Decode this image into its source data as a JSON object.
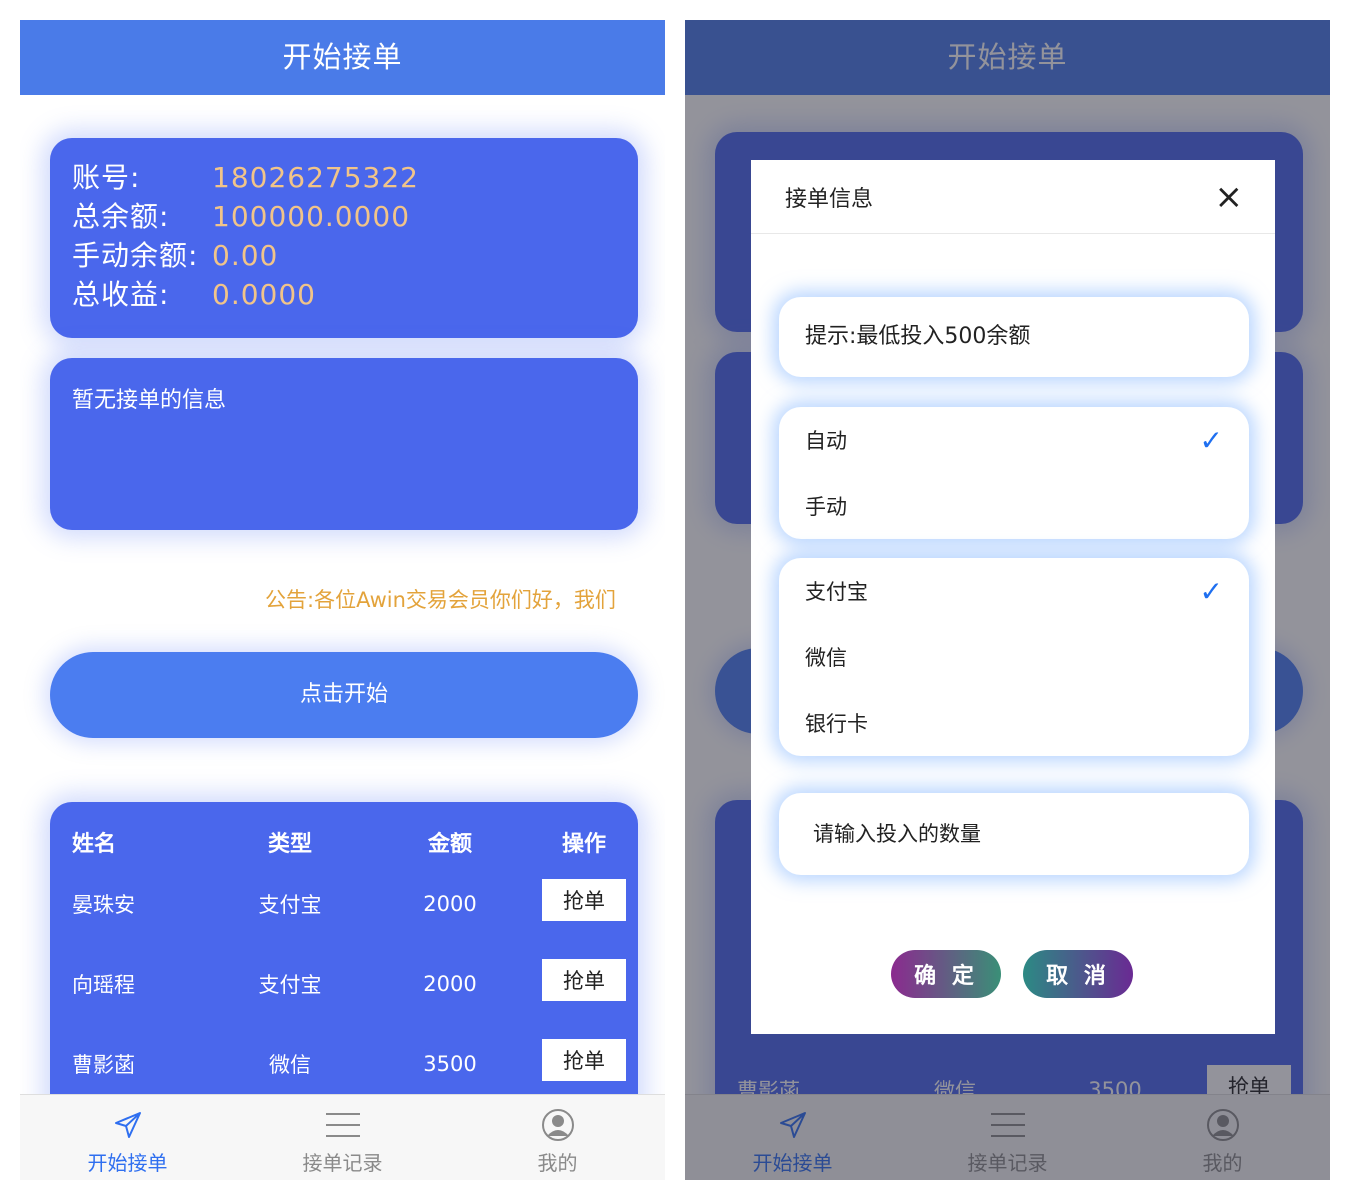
{
  "colors": {
    "header": "#4a7be8",
    "card": "#4a67ec",
    "accent_value": "#f1c489",
    "notice": "#e3a33b",
    "tab_active": "#2f6ff0",
    "check": "#1e6ff0"
  },
  "left": {
    "header_title": "开始接单",
    "account": [
      {
        "label": "账号:",
        "value": "18026275322"
      },
      {
        "label": "总余额:",
        "value": "100000.0000"
      },
      {
        "label": "手动余额:",
        "value": "0.00"
      },
      {
        "label": "总收益:",
        "value": "0.0000"
      }
    ],
    "no_order_info": "暂无接单的信息",
    "notice": "公告:各位Awin交易会员你们好，我们",
    "start_button": "点击开始",
    "table": {
      "headers": [
        "姓名",
        "类型",
        "金额",
        "操作"
      ],
      "rows": [
        {
          "name": "晏珠安",
          "type": "支付宝",
          "amount": "2000",
          "action": "抢单"
        },
        {
          "name": "向瑶程",
          "type": "支付宝",
          "amount": "2000",
          "action": "抢单"
        },
        {
          "name": "曹影菡",
          "type": "微信",
          "amount": "3500",
          "action": "抢单"
        }
      ]
    }
  },
  "tabs": [
    {
      "label": "开始接单",
      "icon": "send-icon"
    },
    {
      "label": "接单记录",
      "icon": "list-icon"
    },
    {
      "label": "我的",
      "icon": "user-icon"
    }
  ],
  "right": {
    "header_title": "开始接单",
    "bg_row": {
      "name": "曹影菡",
      "type": "微信",
      "amount": "3500",
      "action": "抢单"
    },
    "dialog": {
      "title": "接单信息",
      "close": "×",
      "tip": "提示:最低投入500余额",
      "mode_options": [
        {
          "label": "自动",
          "checked": true
        },
        {
          "label": "手动",
          "checked": false
        }
      ],
      "pay_options": [
        {
          "label": "支付宝",
          "checked": true
        },
        {
          "label": "微信",
          "checked": false
        },
        {
          "label": "银行卡",
          "checked": false
        }
      ],
      "qty_placeholder": "请输入投入的数量",
      "confirm": "确 定",
      "cancel": "取 消"
    }
  }
}
